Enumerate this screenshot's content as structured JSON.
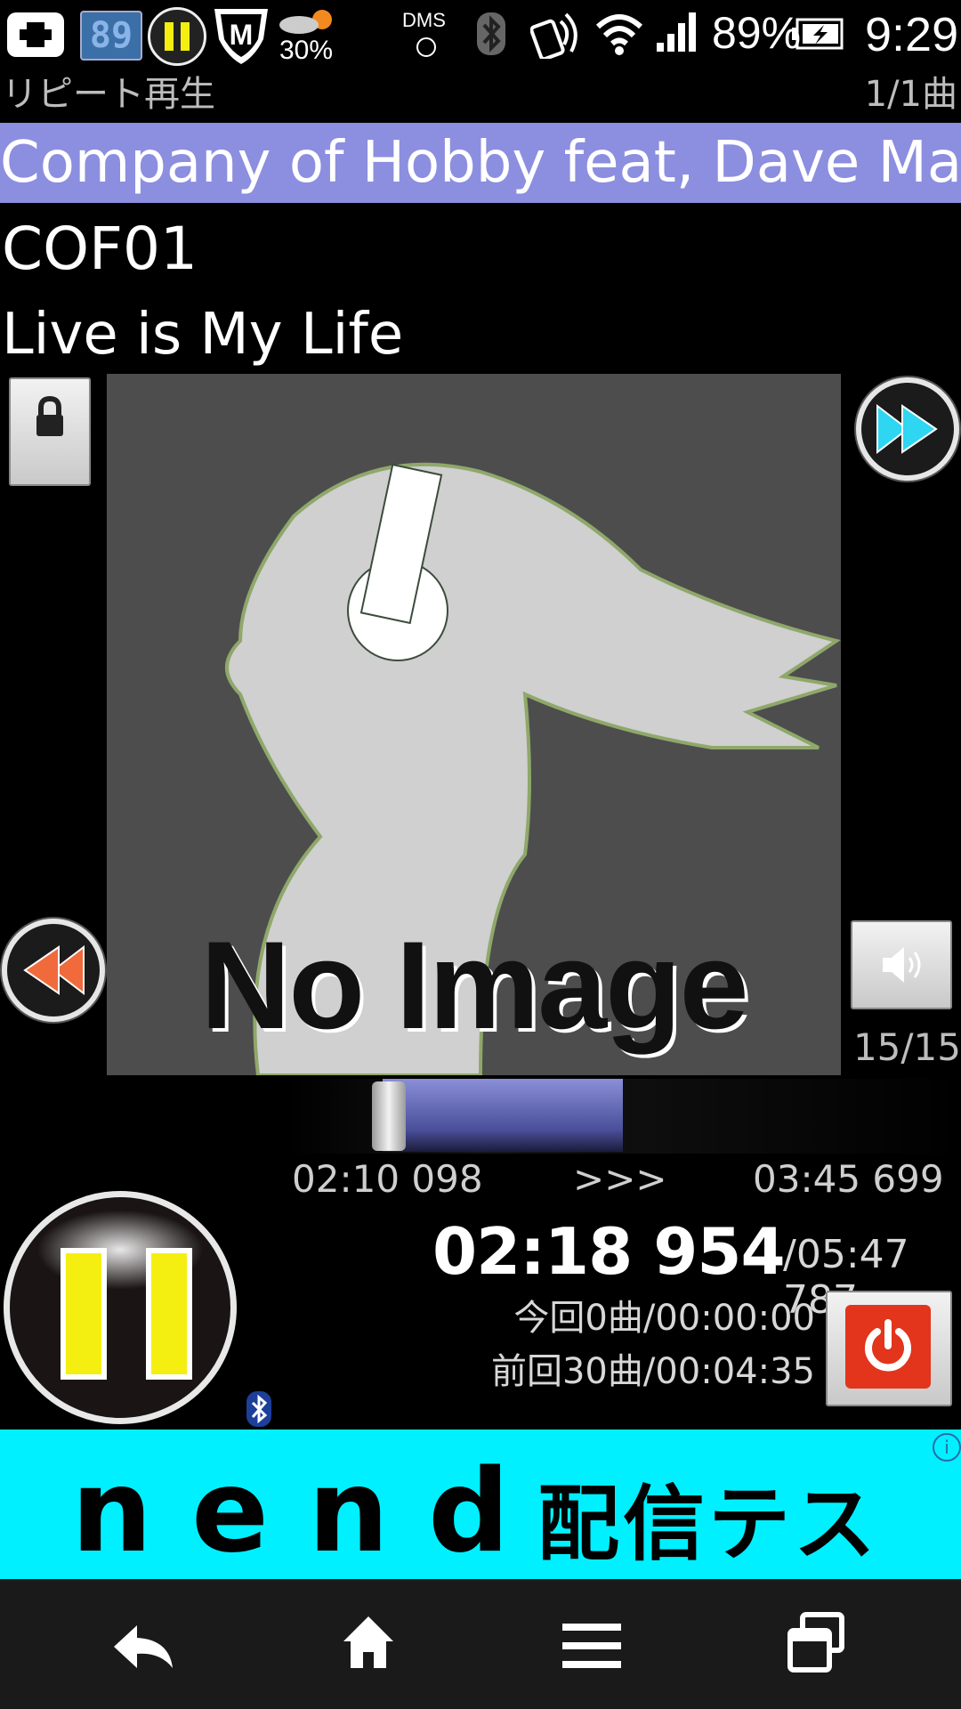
{
  "status_bar": {
    "battery_badge": "89",
    "weather_percent": "30%",
    "dms_label": "DMS",
    "battery_percent": "89%",
    "clock": "9:29"
  },
  "header": {
    "repeat_mode": "リピート再生",
    "track_count": "1/1曲"
  },
  "track": {
    "artist": "Company of Hobby feat, Dave Mash",
    "album": "COF01",
    "title": "Live is My Life"
  },
  "album_art": {
    "placeholder_text": "No Image"
  },
  "volume": {
    "value": "15/15"
  },
  "ab_repeat": {
    "start_time": "02:10 098",
    "arrow": ">>>",
    "end_time": "03:45 699"
  },
  "playback": {
    "current_time": "02:18 954",
    "total_time": "/05:47 787",
    "this_session": "今回0曲/00:00:00",
    "previous_session": "前回30曲/00:04:35",
    "progress_fraction": 0.4
  },
  "ad": {
    "logo": "nend",
    "text": "配信テスト",
    "info": "i"
  },
  "colors": {
    "artist_bar": "#8c8edf",
    "ad_background": "#00f0ff",
    "pause_icon": "#f4ef10",
    "power_button": "#e2351c",
    "next_arrow": "#2ed6f2",
    "prev_arrow": "#f06a3c"
  },
  "icons": {
    "lock": "lock-icon",
    "next": "fast-forward-icon",
    "prev": "rewind-icon",
    "volume": "speaker-icon",
    "pause": "pause-icon",
    "power": "power-icon",
    "bluetooth": "bluetooth-icon",
    "nav_back": "back-icon",
    "nav_home": "home-icon",
    "nav_menu": "menu-icon",
    "nav_recent": "recent-apps-icon"
  }
}
